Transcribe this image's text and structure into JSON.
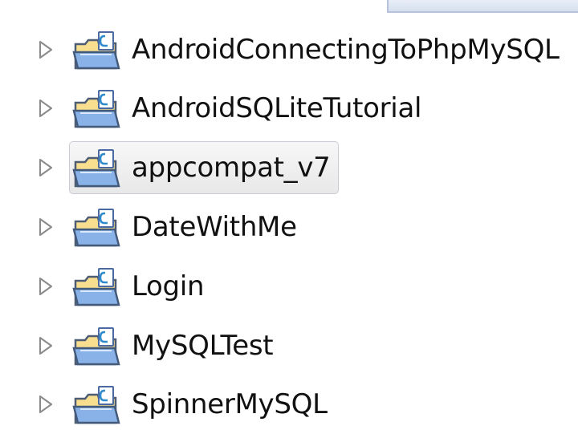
{
  "project_explorer": {
    "projects": [
      {
        "label": "AndroidConnectingToPhpMySQL",
        "selected": false
      },
      {
        "label": "AndroidSQLiteTutorial",
        "selected": false
      },
      {
        "label": "appcompat_v7",
        "selected": true
      },
      {
        "label": "DateWithMe",
        "selected": false
      },
      {
        "label": "Login",
        "selected": false
      },
      {
        "label": "MySQLTest",
        "selected": false
      },
      {
        "label": "SpinnerMySQL",
        "selected": false
      }
    ]
  },
  "icons": {
    "expand": "collapsed-tree-arrow-icon",
    "project": "project-folder-icon"
  },
  "colors": {
    "selection_border": "#c9ccd2",
    "selection_fill": "#ececec",
    "folder_fill": "#fbe7a6",
    "folder_blue": "#7ea6dd",
    "arrow_stroke": "#8a8a8a"
  }
}
